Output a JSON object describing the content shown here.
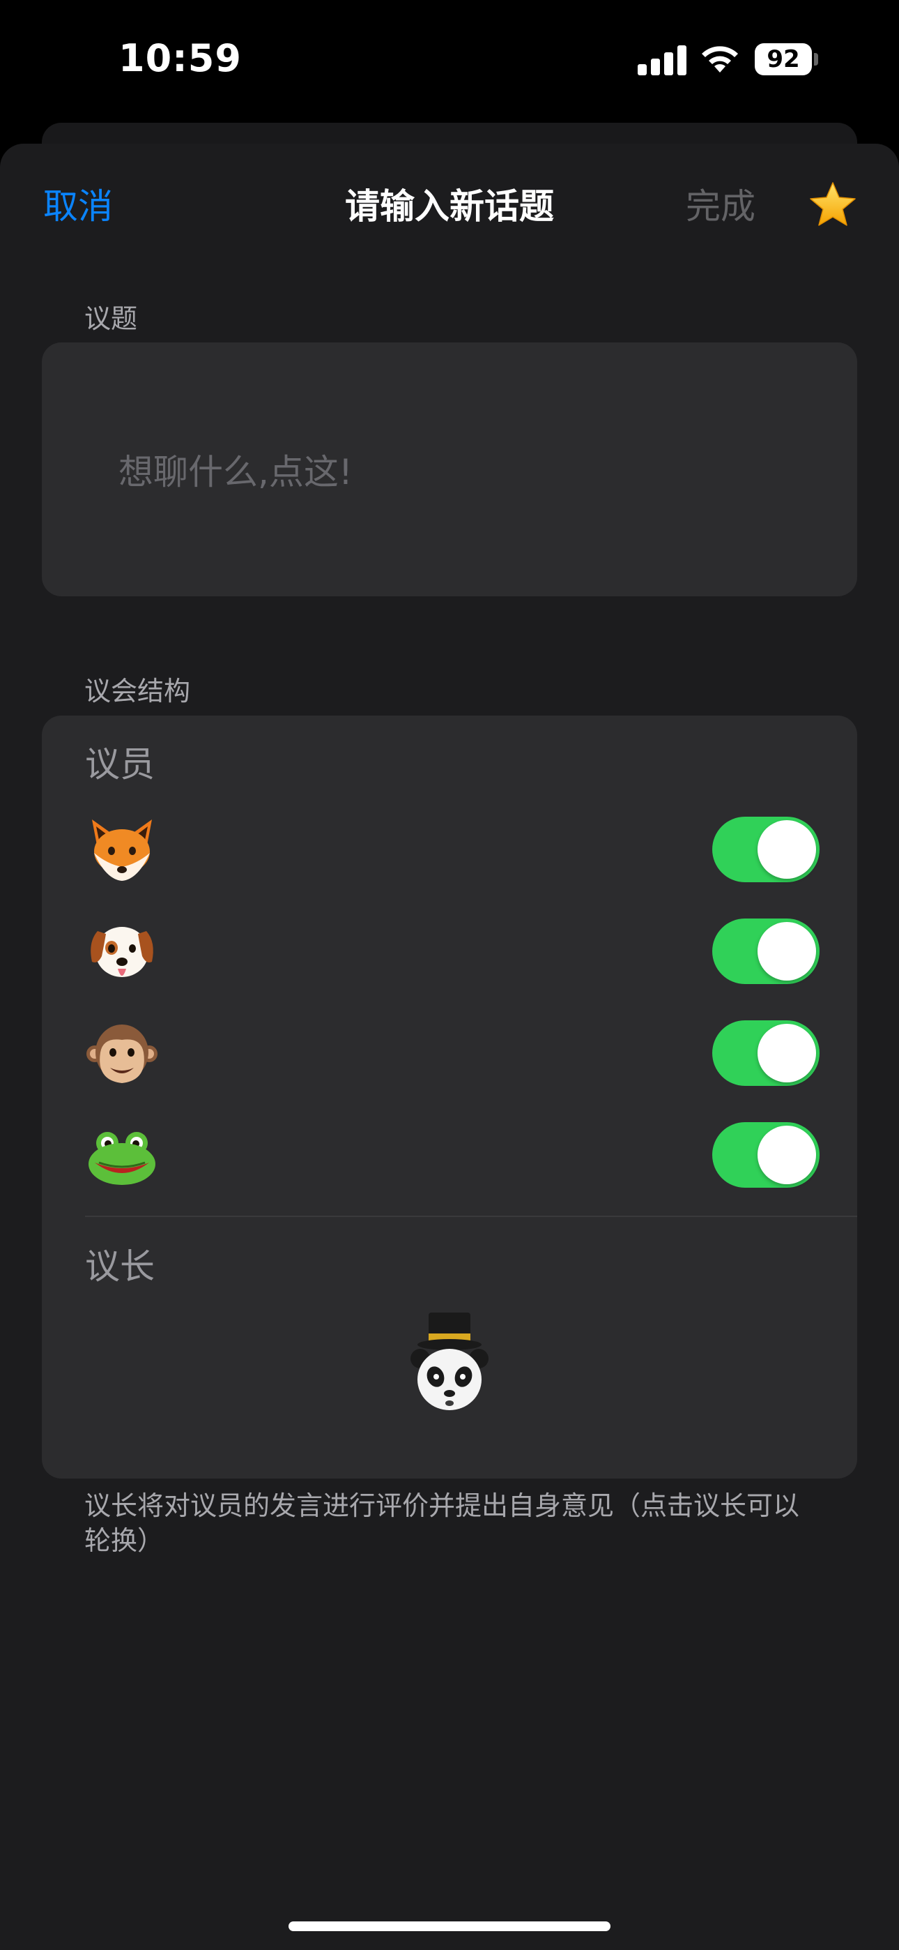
{
  "status_bar": {
    "time": "10:59",
    "battery": "92"
  },
  "nav": {
    "cancel_label": "取消",
    "title": "请输入新话题",
    "done_label": "完成"
  },
  "topic": {
    "section_label": "议题",
    "placeholder": "想聊什么,点这!"
  },
  "structure": {
    "section_label": "议会结构",
    "members_title": "议员",
    "members": [
      {
        "animal": "fox",
        "enabled": true
      },
      {
        "animal": "dog",
        "enabled": true
      },
      {
        "animal": "monkey",
        "enabled": true
      },
      {
        "animal": "frog",
        "enabled": true
      }
    ],
    "chair_title": "议长",
    "chair_animal": "panda with top hat",
    "footnote": "议长将对议员的发言进行评价并提出自身意见（点击议长可以轮换）"
  },
  "colors": {
    "accent": "#0a84ff",
    "toggle_on": "#30d158",
    "sheet_bg": "#1c1c1e",
    "card_bg": "#2c2c2e"
  }
}
